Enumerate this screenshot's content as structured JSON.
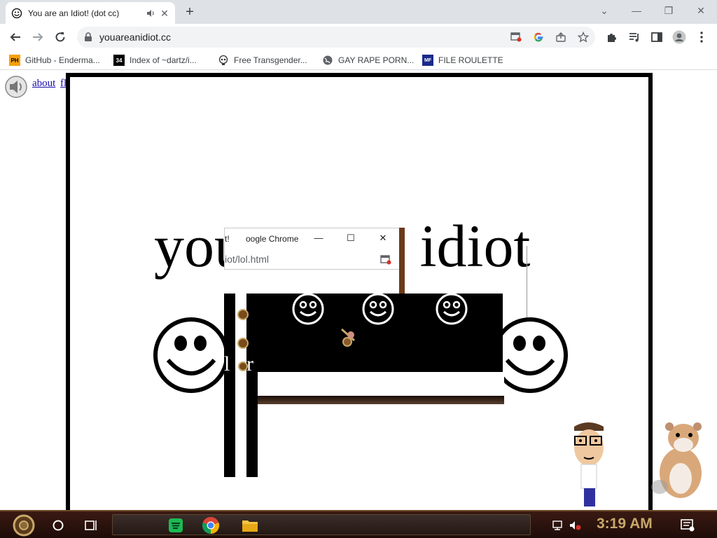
{
  "browser": {
    "tab_title": "You are an Idiot! (dot cc)",
    "tab_close": "✕",
    "new_tab": "+",
    "window_controls": {
      "minimize": "—",
      "restore": "❐",
      "close": "✕",
      "tab_search": "⌄"
    },
    "url": "youareanidiot.cc"
  },
  "bookmarks": [
    {
      "icon": "PH",
      "label": "GitHub - Enderma..."
    },
    {
      "icon": "34",
      "label": "Index of ~dartz/i..."
    },
    {
      "icon": "skull",
      "label": "Free Transgender..."
    },
    {
      "icon": "globe",
      "label": "GAY RAPE PORN..."
    },
    {
      "icon": "MF",
      "label": "FILE ROULETTE"
    }
  ],
  "page": {
    "links": {
      "about": "about",
      "flash": "flash"
    },
    "headline": "you are an idiot",
    "frag_left": "l",
    "frag_right": "r"
  },
  "popup": {
    "title_fragment": "t!",
    "title": "oogle Chrome",
    "url_fragment": "iot",
    "url_path": "/lol.html",
    "controls": {
      "minimize": "—",
      "maximize": "☐",
      "close": "✕"
    }
  },
  "taskbar": {
    "clock": "3:19 AM"
  },
  "colors": {
    "tab_strip": "#dee1e6",
    "link": "#1a0dab",
    "taskbar": "#2a140c",
    "clock": "#c8a86a"
  }
}
